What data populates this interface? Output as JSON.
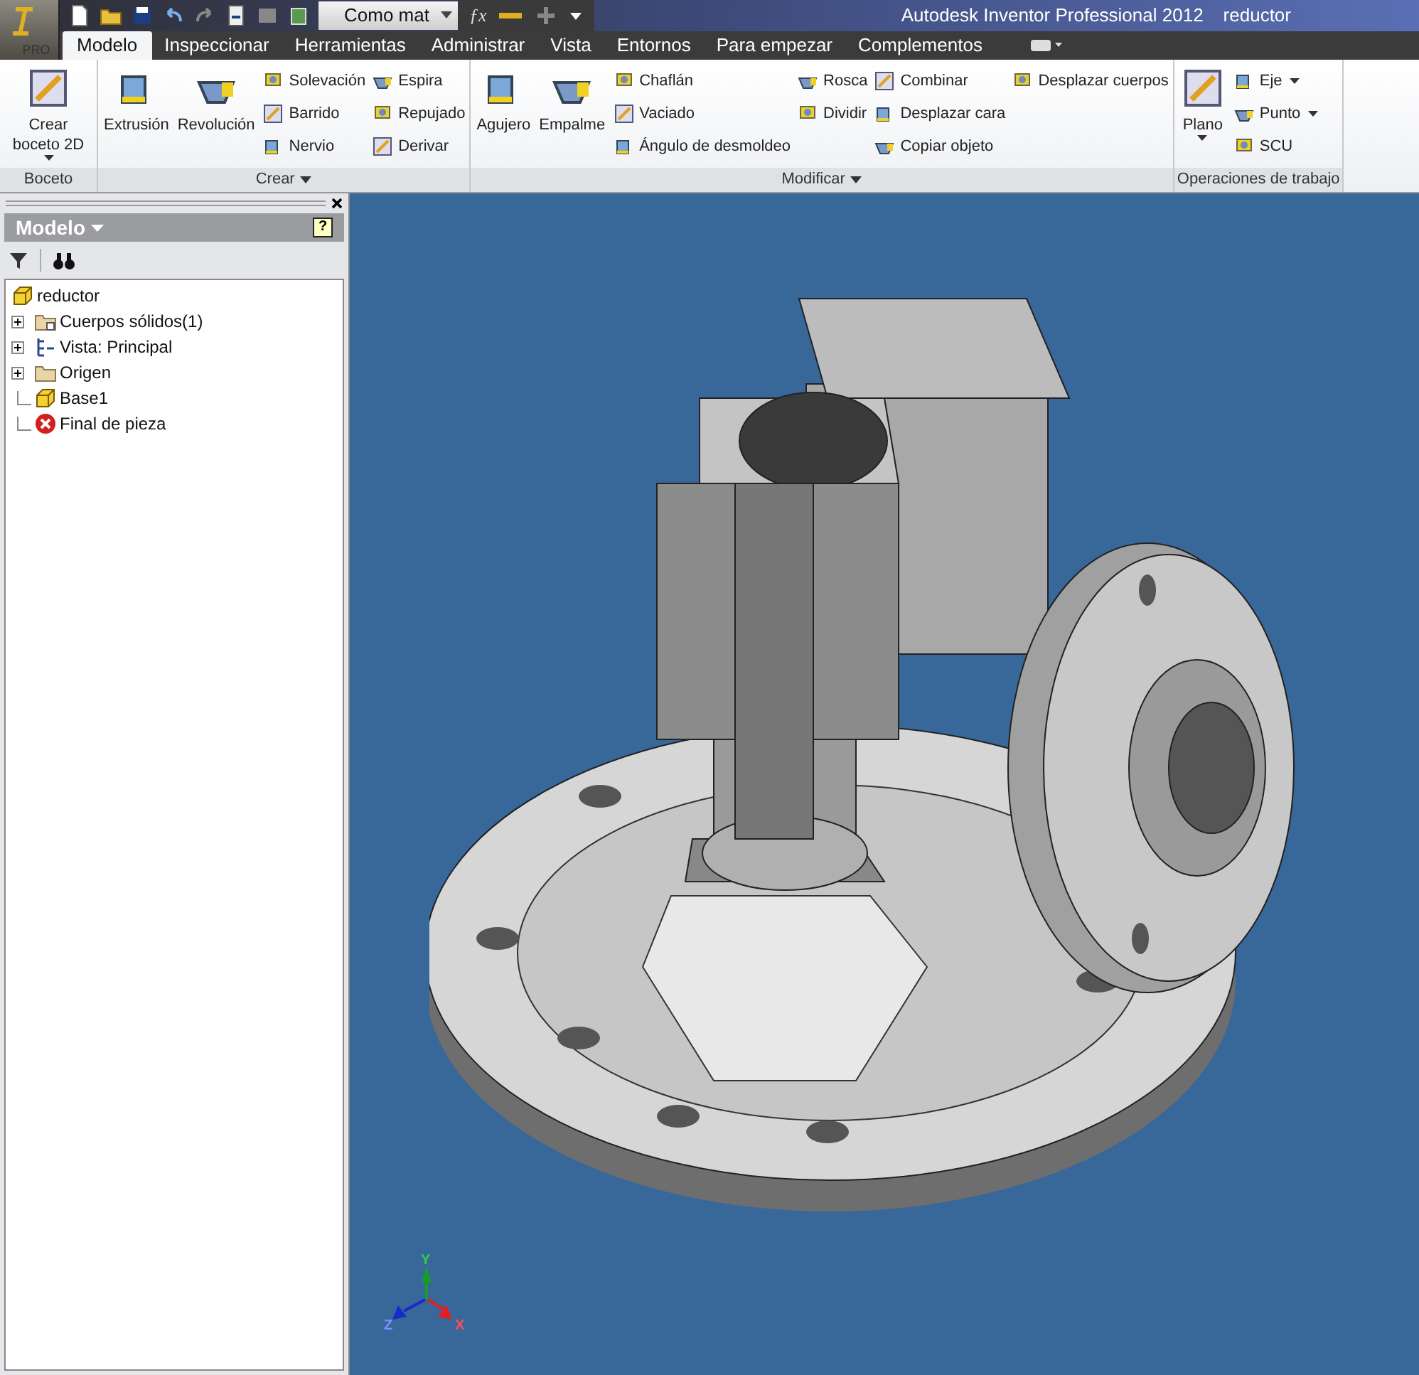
{
  "window": {
    "title": "Autodesk Inventor Professional 2012",
    "document": "reductor"
  },
  "app_button": {
    "label": "PRO"
  },
  "quick_access": {
    "combo_value": "Como mat",
    "function_glyph": "ƒx"
  },
  "tabs": [
    {
      "label": "Modelo",
      "selected": true
    },
    {
      "label": "Inspeccionar",
      "selected": false
    },
    {
      "label": "Herramientas",
      "selected": false
    },
    {
      "label": "Administrar",
      "selected": false
    },
    {
      "label": "Vista",
      "selected": false
    },
    {
      "label": "Entornos",
      "selected": false
    },
    {
      "label": "Para empezar",
      "selected": false
    },
    {
      "label": "Complementos",
      "selected": false
    }
  ],
  "ribbon_panels": [
    {
      "title": "Boceto",
      "has_menu": false,
      "columns": [
        [
          {
            "label": "Crear boceto 2D",
            "kind": "large",
            "dropdown": true
          }
        ]
      ]
    },
    {
      "title": "Crear",
      "has_menu": true,
      "columns": [
        [
          {
            "label": "Extrusión",
            "kind": "large",
            "dropdown": false
          }
        ],
        [
          {
            "label": "Revolución",
            "kind": "large",
            "dropdown": false
          }
        ],
        [
          {
            "label": "Solevación",
            "kind": "small",
            "dropdown": false
          },
          {
            "label": "Barrido",
            "kind": "small",
            "dropdown": false
          },
          {
            "label": "Nervio",
            "kind": "small",
            "dropdown": false
          }
        ],
        [
          {
            "label": "Espira",
            "kind": "small",
            "dropdown": false
          },
          {
            "label": "Repujado",
            "kind": "small",
            "dropdown": false
          },
          {
            "label": "Derivar",
            "kind": "small",
            "dropdown": false
          }
        ]
      ]
    },
    {
      "title": "Modificar",
      "has_menu": true,
      "columns": [
        [
          {
            "label": "Agujero",
            "kind": "large",
            "dropdown": false
          }
        ],
        [
          {
            "label": "Empalme",
            "kind": "large",
            "dropdown": false
          }
        ],
        [
          {
            "label": "Chaflán",
            "kind": "small",
            "dropdown": false
          },
          {
            "label": "Vaciado",
            "kind": "small",
            "dropdown": false
          },
          {
            "label": "Ángulo de desmoldeo",
            "kind": "small",
            "dropdown": false
          }
        ],
        [
          {
            "label": "Rosca",
            "kind": "small",
            "dropdown": false
          },
          {
            "label": "Dividir",
            "kind": "small",
            "dropdown": false
          }
        ],
        [
          {
            "label": "Combinar",
            "kind": "small",
            "dropdown": false
          },
          {
            "label": "Desplazar cara",
            "kind": "small",
            "dropdown": false
          },
          {
            "label": "Copiar objeto",
            "kind": "small",
            "dropdown": false
          }
        ],
        [
          {
            "label": "Desplazar cuerpos",
            "kind": "small",
            "dropdown": false
          }
        ]
      ]
    },
    {
      "title": "Operaciones de trabajo",
      "has_menu": false,
      "columns": [
        [
          {
            "label": "Plano",
            "kind": "large",
            "dropdown": true
          }
        ],
        [
          {
            "label": "Eje",
            "kind": "small",
            "dropdown": true
          },
          {
            "label": "Punto",
            "kind": "small",
            "dropdown": true
          },
          {
            "label": "SCU",
            "kind": "small",
            "dropdown": false
          }
        ]
      ]
    }
  ],
  "browser": {
    "title": "Modelo",
    "help_glyph": "?",
    "tree": [
      {
        "label": "reductor",
        "kind": "part",
        "children": [
          {
            "label": "Cuerpos sólidos(1)",
            "kind": "solids",
            "expandable": true
          },
          {
            "label": "Vista: Principal",
            "kind": "view",
            "expandable": true
          },
          {
            "label": "Origen",
            "kind": "folder",
            "expandable": true
          },
          {
            "label": "Base1",
            "kind": "part",
            "expandable": false
          },
          {
            "label": "Final de pieza",
            "kind": "end",
            "expandable": false
          }
        ]
      }
    ]
  },
  "viewport": {
    "triad": {
      "x": "X",
      "y": "Y",
      "z": "Z"
    }
  }
}
